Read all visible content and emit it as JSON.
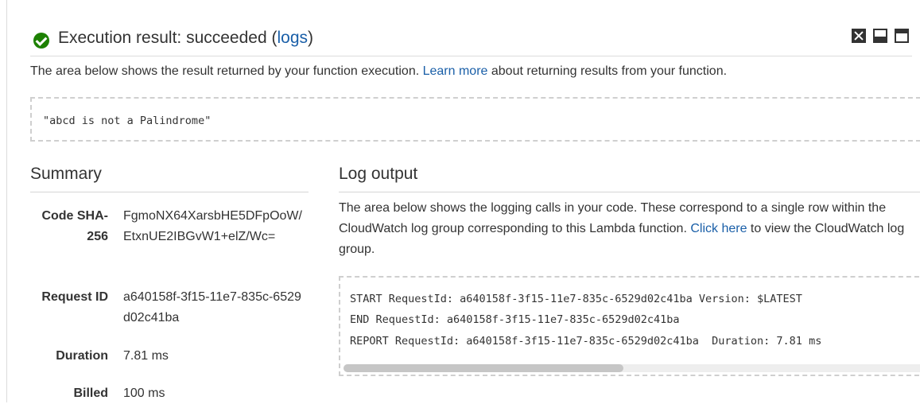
{
  "header": {
    "title_prefix": "Execution result: succeeded (",
    "title_link": "logs",
    "title_suffix": ")",
    "status_color": "#1d8102",
    "icons": [
      "close-icon",
      "minimize-icon",
      "maximize-icon"
    ]
  },
  "description": {
    "before": "The area below shows the result returned by your function execution. ",
    "link": "Learn more",
    "after": " about returning results from your function."
  },
  "result": {
    "text": "\"abcd is not a Palindrome\""
  },
  "summary": {
    "title": "Summary",
    "code_sha_label": "Code SHA-256",
    "code_sha_value": "FgmoNX64XarsbHE5DFpOoW/EtxnUE2IBGvW1+elZ/Wc=",
    "request_id_label": "Request ID",
    "request_id_value": "a640158f-3f15-11e7-835c-6529d02c41ba",
    "duration_label": "Duration",
    "duration_value": "7.81 ms",
    "billed_label": "Billed",
    "billed_value": "100 ms"
  },
  "log": {
    "title": "Log output",
    "desc_before": "The area below shows the logging calls in your code. These correspond to a single row within the CloudWatch log group corresponding to this Lambda function. ",
    "desc_link": "Click here",
    "desc_after": " to view the CloudWatch log group.",
    "lines": [
      "START RequestId: a640158f-3f15-11e7-835c-6529d02c41ba Version: $LATEST",
      "END RequestId: a640158f-3f15-11e7-835c-6529d02c41ba",
      "REPORT RequestId: a640158f-3f15-11e7-835c-6529d02c41ba  Duration: 7.81 ms"
    ]
  },
  "colors": {
    "link": "#1a5fa8",
    "success": "#1d8102"
  }
}
